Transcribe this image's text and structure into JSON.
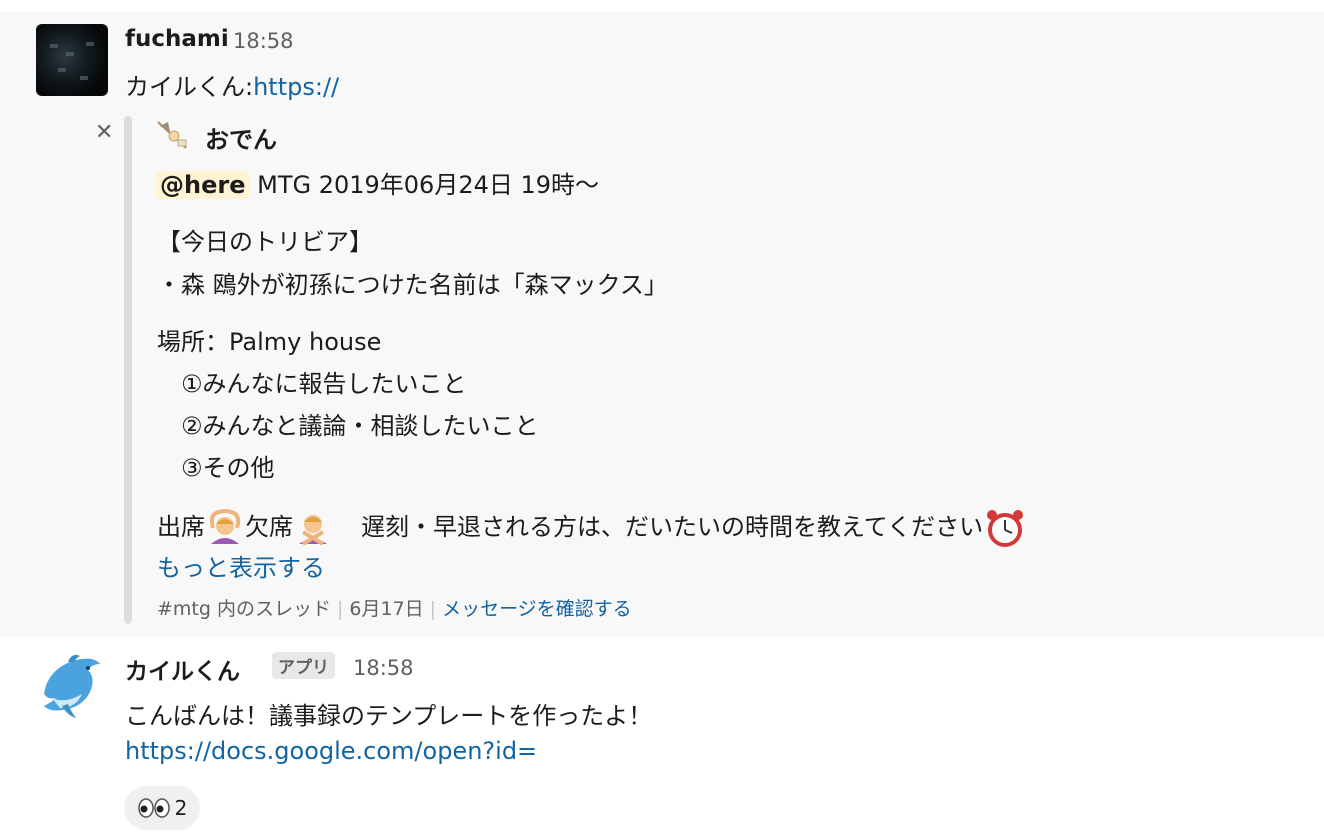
{
  "message1": {
    "username": "fuchami",
    "time": "18:58",
    "text_prefix": "カイルくん:",
    "text_link": "https://",
    "attachment": {
      "title": "おでん",
      "mention": "@here",
      "mtg_line": " MTG 2019年06月24日 19時〜",
      "trivia_heading": "【今日のトリビア】",
      "trivia_line": "・森 鴎外が初孫につけた名前は「森マックス」",
      "place_line": "場所：Palmy house",
      "agenda": [
        "①みんなに報告したいこと",
        "②みんなと議論・相談したいこと",
        "③その他"
      ],
      "attendance_present": "出席",
      "attendance_absent": "欠席",
      "attendance_note": "遅刻・早退される方は、だいたいの時間を教えてください",
      "show_more": "もっと表示する",
      "thread_info": "#mtg 内のスレッド",
      "date": "6月17日",
      "view_message": "メッセージを確認する"
    }
  },
  "message2": {
    "username": "カイルくん",
    "badge": "アプリ",
    "time": "18:58",
    "text": "こんばんは！議事録のテンプレートを作ったよ！",
    "link": "https://docs.google.com/open?id=",
    "reaction_count": "2"
  },
  "colors": {
    "link": "#1264a3",
    "mention_bg": "#fff3d4",
    "attachment_bar": "#dddddd"
  }
}
